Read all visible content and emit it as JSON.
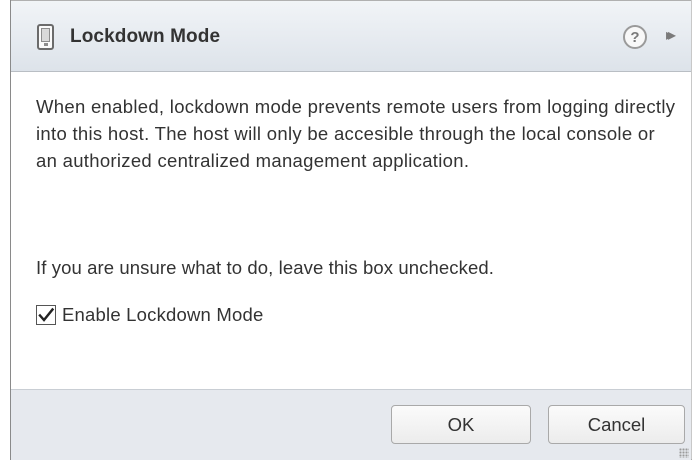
{
  "dialog": {
    "title": "Lockdown Mode",
    "title_icon": "mobile-device-icon",
    "help_icon": "help-icon",
    "help_glyph": "?",
    "expand_icon": "expand-icon",
    "expand_glyph": "▸▸"
  },
  "content": {
    "description": "When enabled, lockdown mode prevents remote users from logging directly into this host. The host will only be accesible through the local console or an authorized centralized management application.",
    "hint": "If you are unsure what to do, leave this box unchecked.",
    "checkbox": {
      "label": "Enable Lockdown Mode",
      "checked": true
    }
  },
  "footer": {
    "ok_label": "OK",
    "cancel_label": "Cancel"
  },
  "colors": {
    "titlebar": "#dde3ea",
    "footer": "#e6e9ee",
    "text": "#333333"
  }
}
